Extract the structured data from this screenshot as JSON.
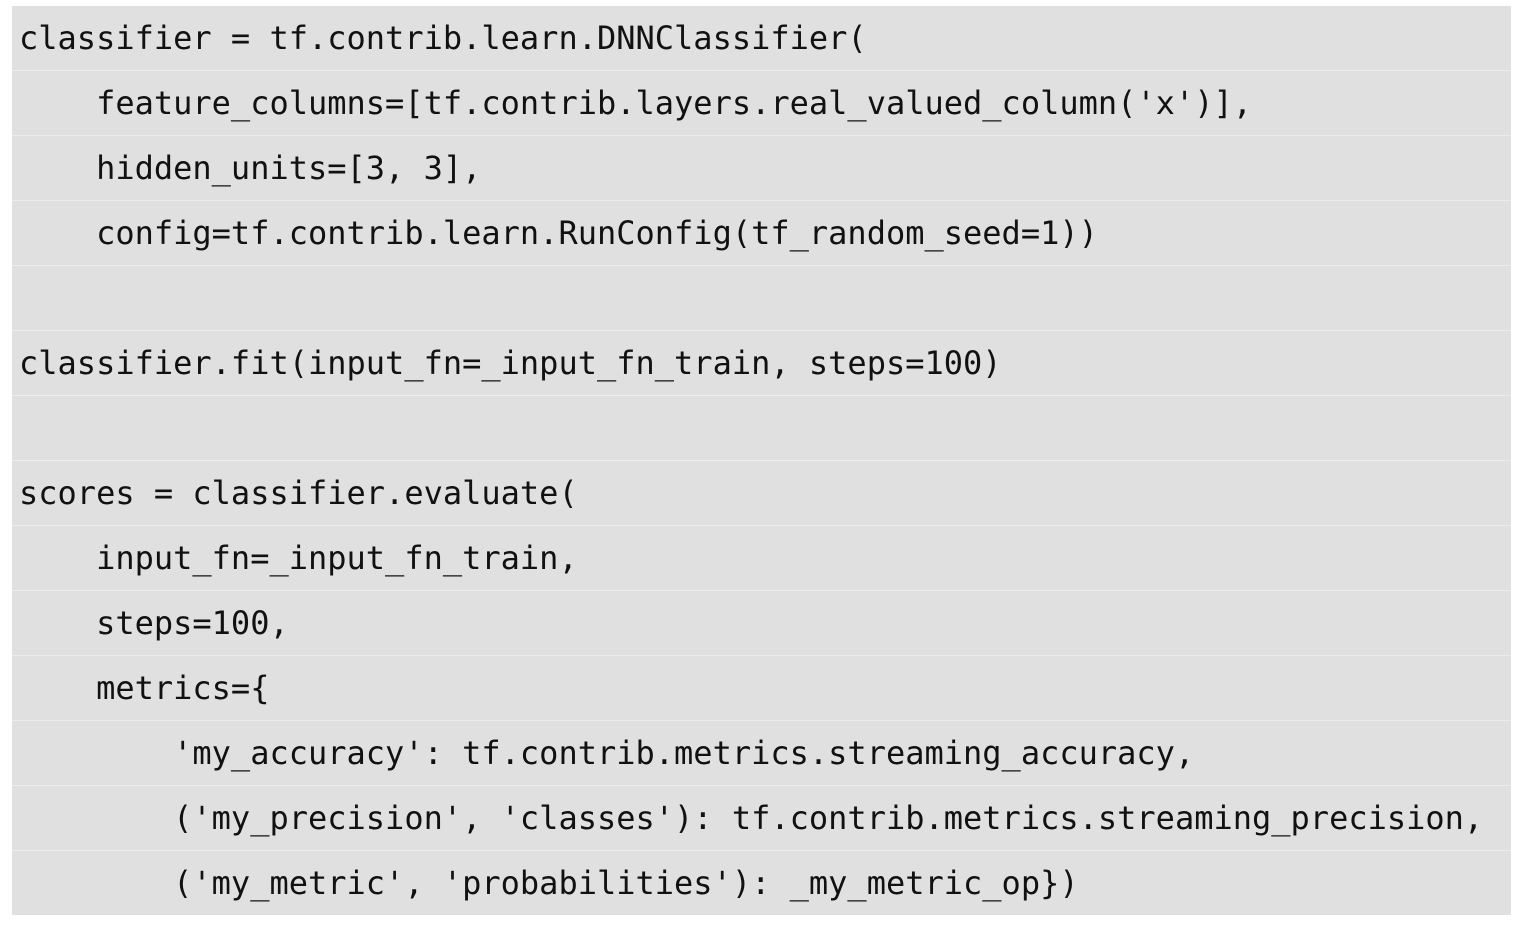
{
  "code": {
    "lines": [
      "classifier = tf.contrib.learn.DNNClassifier(",
      "    feature_columns=[tf.contrib.layers.real_valued_column('x')],",
      "    hidden_units=[3, 3],",
      "    config=tf.contrib.learn.RunConfig(tf_random_seed=1))",
      "",
      "classifier.fit(input_fn=_input_fn_train, steps=100)",
      "",
      "scores = classifier.evaluate(",
      "    input_fn=_input_fn_train,",
      "    steps=100,",
      "    metrics={",
      "        'my_accuracy': tf.contrib.metrics.streaming_accuracy,",
      "        ('my_precision', 'classes'): tf.contrib.metrics.streaming_precision,",
      "        ('my_metric', 'probabilities'): _my_metric_op})"
    ]
  }
}
